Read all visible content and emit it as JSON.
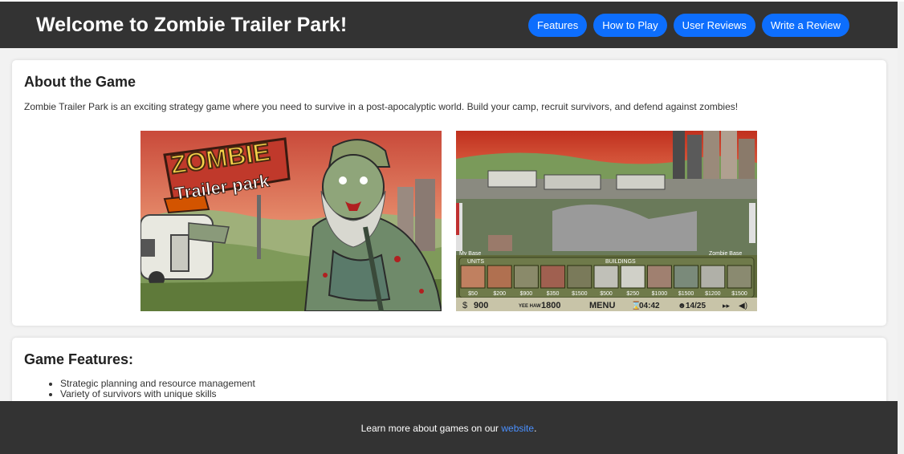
{
  "header": {
    "title": "Welcome to Zombie Trailer Park!",
    "nav": [
      "Features",
      "How to Play",
      "User Reviews",
      "Write a Review"
    ]
  },
  "about": {
    "heading": "About the Game",
    "text": "Zombie Trailer Park is an exciting strategy game where you need to survive in a post-apocalyptic world. Build your camp, recruit survivors, and defend against zombies!",
    "images": [
      {
        "logo_line1": "ZOMBIE",
        "logo_line2": "Trailer park"
      },
      {
        "my_base": "My Base",
        "zombie_base": "Zombie Base",
        "units_label": "UNITS",
        "buildings_label": "BUILDINGS",
        "prices": [
          "$50",
          "$200",
          "$900",
          "$350",
          "$1500",
          "$500",
          "$250",
          "$1000",
          "$1500",
          "$1200",
          "$1500"
        ],
        "money": "900",
        "yeehaw_label": "YEE HAW",
        "yeehaw_value": "1800",
        "menu": "MENU",
        "timer": "04:42",
        "population": "14/25"
      }
    ]
  },
  "features": {
    "heading": "Game Features:",
    "items": [
      "Strategic planning and resource management",
      "Variety of survivors with unique skills"
    ]
  },
  "footer": {
    "text_before": "Learn more about games on our ",
    "link_text": "website",
    "text_after": "."
  },
  "colors": {
    "header_bg": "#333333",
    "button_bg": "#0d6efd",
    "link": "#4a90ff"
  }
}
